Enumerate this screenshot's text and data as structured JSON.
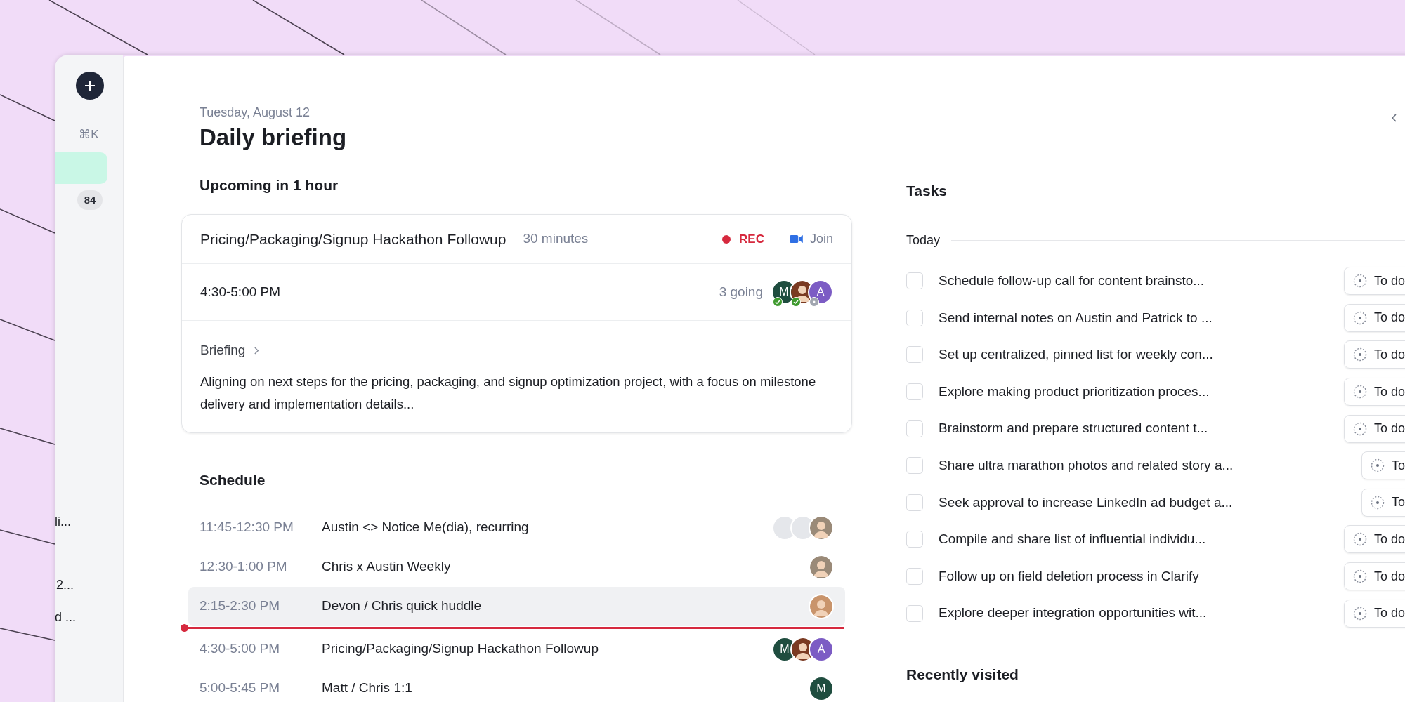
{
  "sidebar": {
    "shortcut": "⌘K",
    "items": [
      {
        "selected": true
      }
    ],
    "badge": "84",
    "truncated_items": [
      "li...",
      "2...",
      "d ..."
    ]
  },
  "header": {
    "date": "Tuesday, August 12",
    "title": "Daily briefing"
  },
  "upcoming": {
    "heading": "Upcoming in 1 hour",
    "title": "Pricing/Packaging/Signup Hackathon Followup",
    "duration": "30 minutes",
    "recording": true,
    "rec_label": "REC",
    "join_label": "Join",
    "time": "4:30-5:00 PM",
    "going": "3 going",
    "attendees": [
      {
        "kind": "initial",
        "letter": "M",
        "color": "#1f4d3f",
        "accepted": true
      },
      {
        "kind": "photo",
        "color": "#7a3a22",
        "accepted": true
      },
      {
        "kind": "initial",
        "letter": "A",
        "color": "#7c5cc4",
        "accepted": false
      }
    ],
    "briefing_label": "Briefing",
    "briefing_text": "Aligning on next steps for the pricing, packaging, and signup optimization project, with a focus on milestone delivery and implementation details..."
  },
  "schedule": {
    "heading": "Schedule",
    "items": [
      {
        "kind": "event",
        "time": "11:45-12:30 PM",
        "title": "Austin <> Notice Me(dia), recurring",
        "selected": false,
        "attendees": [
          {
            "kind": "placeholder",
            "color": "#e5e7eb"
          },
          {
            "kind": "placeholder",
            "color": "#e5e7eb"
          },
          {
            "kind": "photo",
            "color": "#9a8a78"
          }
        ]
      },
      {
        "kind": "event",
        "time": "12:30-1:00 PM",
        "title": "Chris x Austin Weekly",
        "selected": false,
        "attendees": [
          {
            "kind": "photo",
            "color": "#9a8a78"
          }
        ]
      },
      {
        "kind": "event",
        "time": "2:15-2:30 PM",
        "title": "Devon / Chris quick huddle",
        "selected": true,
        "attendees": [
          {
            "kind": "photo",
            "color": "#c9946b"
          }
        ]
      },
      {
        "kind": "now"
      },
      {
        "kind": "event",
        "time": "4:30-5:00 PM",
        "title": "Pricing/Packaging/Signup Hackathon Followup",
        "selected": false,
        "attendees": [
          {
            "kind": "initial",
            "letter": "M",
            "color": "#1f4d3f"
          },
          {
            "kind": "photo",
            "color": "#7a3a22"
          },
          {
            "kind": "initial",
            "letter": "A",
            "color": "#7c5cc4"
          }
        ]
      },
      {
        "kind": "event",
        "time": "5:00-5:45 PM",
        "title": "Matt / Chris 1:1",
        "selected": false,
        "attendees": [
          {
            "kind": "initial",
            "letter": "M",
            "color": "#1f4d3f"
          }
        ]
      }
    ]
  },
  "tasks": {
    "heading": "Tasks",
    "group": "Today",
    "items": [
      {
        "text": "Schedule follow-up call for content brainsto...",
        "checked": false,
        "status": "To do"
      },
      {
        "text": "Send internal notes on Austin and Patrick to ...",
        "checked": false,
        "status": "To do"
      },
      {
        "text": "Set up centralized, pinned list for weekly con...",
        "checked": false,
        "status": "To do"
      },
      {
        "text": "Explore making product prioritization proces...",
        "checked": false,
        "status": "To do"
      },
      {
        "text": "Brainstorm and prepare structured content t...",
        "checked": false,
        "status": "To do"
      },
      {
        "text": "Share ultra marathon photos and related story a...",
        "checked": false,
        "status": "To"
      },
      {
        "text": "Seek approval to increase LinkedIn ad budget a...",
        "checked": false,
        "status": "To"
      },
      {
        "text": "Compile and share list of influential individu...",
        "checked": false,
        "status": "To do"
      },
      {
        "text": "Follow up on field deletion process in Clarify",
        "checked": false,
        "status": "To do"
      },
      {
        "text": "Explore deeper integration opportunities wit...",
        "checked": false,
        "status": "To do"
      }
    ]
  },
  "recently_visited": {
    "heading": "Recently visited"
  }
}
